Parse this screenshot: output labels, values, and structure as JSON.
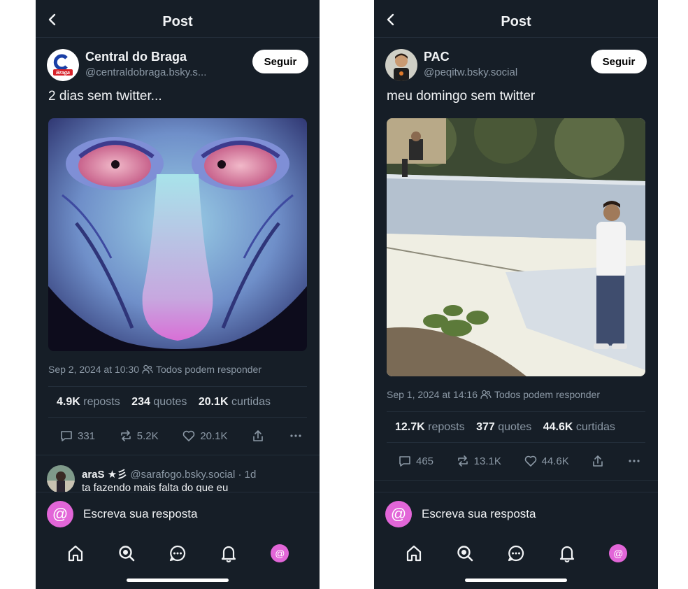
{
  "posts": [
    {
      "header": {
        "title": "Post"
      },
      "author": {
        "name": "Central do Braga",
        "handle": "@centraldobraga.bsky.s...",
        "avatar_text": "Braga"
      },
      "follow_label": "Seguir",
      "text": "2 dias sem twitter...",
      "timestamp": "Sep 2, 2024 at 10:30",
      "reply_setting": "Todos podem responder",
      "stats": {
        "reposts_value": "4.9K",
        "reposts_label": "reposts",
        "quotes_value": "234",
        "quotes_label": "quotes",
        "likes_value": "20.1K",
        "likes_label": "curtidas"
      },
      "actions": {
        "replies": "331",
        "reposts": "5.2K",
        "likes": "20.1K"
      },
      "reply": {
        "name": "araS ★彡",
        "handle": "@sarafogo.bsky.social · 1d",
        "text": "ta fazendo mais falta do que eu"
      },
      "composer_placeholder": "Escreva sua resposta",
      "profile_icon": "@"
    },
    {
      "header": {
        "title": "Post"
      },
      "author": {
        "name": "PAC",
        "handle": "@peqitw.bsky.social"
      },
      "follow_label": "Seguir",
      "text": "meu domingo sem twitter",
      "timestamp": "Sep 1, 2024 at 14:16",
      "reply_setting": "Todos podem responder",
      "stats": {
        "reposts_value": "12.7K",
        "reposts_label": "reposts",
        "quotes_value": "377",
        "quotes_label": "quotes",
        "likes_value": "44.6K",
        "likes_label": "curtidas"
      },
      "actions": {
        "replies": "465",
        "reposts": "13.1K",
        "likes": "44.6K"
      },
      "composer_placeholder": "Escreva sua resposta",
      "profile_icon": "@"
    }
  ],
  "colors": {
    "background": "#161e27",
    "accent": "#e266d8",
    "muted": "#8b98a5",
    "text": "#f1f3f5"
  }
}
